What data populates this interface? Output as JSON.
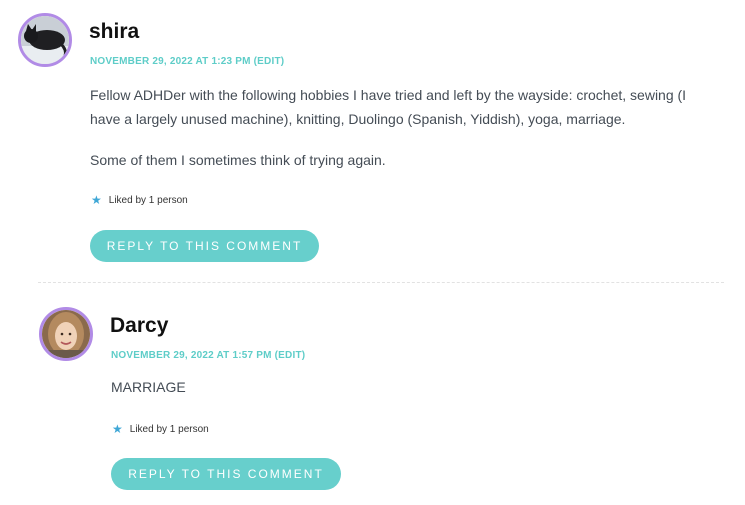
{
  "comments": [
    {
      "author": "shira",
      "date": "NOVEMBER 29, 2022 AT 1:23 PM",
      "edit_label": "(EDIT)",
      "paragraphs": [
        "Fellow ADHDer with the following hobbies I have tried and left by the wayside: crochet, sewing (I have a largely unused machine), knitting, Duolingo (Spanish, Yiddish), yoga, marriage.",
        "Some of them I sometimes think of trying again."
      ],
      "likes": "Liked by 1 person",
      "reply_label": "REPLY TO THIS COMMENT",
      "avatar_icon": "cat-photo-avatar"
    },
    {
      "author": "Darcy",
      "date": "NOVEMBER 29, 2022 AT 1:57 PM",
      "edit_label": "(EDIT)",
      "paragraphs": [
        "MARRIAGE"
      ],
      "likes": "Liked by 1 person",
      "reply_label": "REPLY TO THIS COMMENT",
      "avatar_icon": "woman-photo-avatar"
    }
  ],
  "colors": {
    "accent": "#67cfcc",
    "meta": "#5ecdc8",
    "avatar_ring": "#b18be6",
    "star": "#3fa7d6"
  }
}
